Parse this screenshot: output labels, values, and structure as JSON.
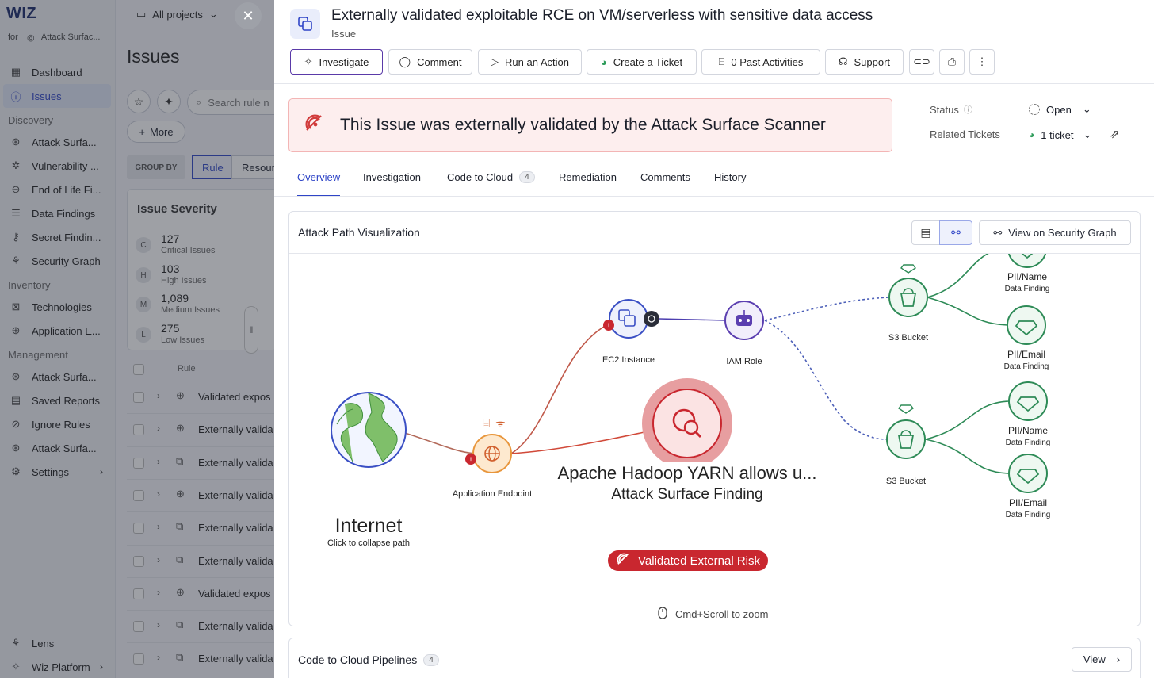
{
  "app": {
    "logo": "WIZ",
    "for_label": "for",
    "workspace": "Attack Surfac...",
    "project_selector": "All projects"
  },
  "sidebar": {
    "top_items": [
      {
        "label": "Dashboard",
        "icon": "dashboard-icon"
      },
      {
        "label": "Issues",
        "icon": "issues-icon",
        "active": true
      }
    ],
    "discovery_label": "Discovery",
    "discovery_items": [
      {
        "label": "Attack Surfa...",
        "icon": "attack-surface-icon"
      },
      {
        "label": "Vulnerability ...",
        "icon": "vulnerability-icon"
      },
      {
        "label": "End of Life Fi...",
        "icon": "end-of-life-icon"
      },
      {
        "label": "Data Findings",
        "icon": "database-icon"
      },
      {
        "label": "Secret Findin...",
        "icon": "key-icon"
      },
      {
        "label": "Security Graph",
        "icon": "graph-icon"
      }
    ],
    "inventory_label": "Inventory",
    "inventory_items": [
      {
        "label": "Technologies",
        "icon": "technologies-icon"
      },
      {
        "label": "Application E...",
        "icon": "globe-icon"
      }
    ],
    "management_label": "Management",
    "management_items": [
      {
        "label": "Attack Surfa...",
        "icon": "attack-surface-icon"
      },
      {
        "label": "Saved Reports",
        "icon": "report-icon"
      },
      {
        "label": "Ignore Rules",
        "icon": "ignore-icon"
      },
      {
        "label": "Attack Surfa...",
        "icon": "attack-surface-icon"
      },
      {
        "label": "Settings",
        "icon": "gear-icon"
      }
    ],
    "bottom_items": [
      {
        "label": "Lens",
        "icon": "lens-icon"
      },
      {
        "label": "Wiz Platform",
        "icon": "platform-icon"
      }
    ]
  },
  "issues_page": {
    "title": "Issues",
    "search_placeholder": "Search rule n",
    "more_label": "More",
    "group_by_label": "GROUP BY",
    "group_rule": "Rule",
    "group_resource": "Resour",
    "severity": {
      "title": "Issue Severity",
      "rows": [
        {
          "badge": "C",
          "count": "127",
          "label": "Critical Issues"
        },
        {
          "badge": "H",
          "count": "103",
          "label": "High Issues"
        },
        {
          "badge": "M",
          "count": "1,089",
          "label": "Medium Issues"
        },
        {
          "badge": "L",
          "count": "275",
          "label": "Low Issues"
        }
      ]
    },
    "table_header": "Rule",
    "rows": [
      {
        "icon": "globe-icon",
        "text": "Validated expos"
      },
      {
        "icon": "globe-icon",
        "text": "Externally valida"
      },
      {
        "icon": "copy-icon",
        "text": "Externally valida"
      },
      {
        "icon": "globe-icon",
        "text": "Externally valida"
      },
      {
        "icon": "copy-icon",
        "text": "Externally valida"
      },
      {
        "icon": "copy-icon",
        "text": "Externally valida"
      },
      {
        "icon": "globe-icon",
        "text": "Validated expos"
      },
      {
        "icon": "copy-icon",
        "text": "Externally valida"
      },
      {
        "icon": "copy-icon",
        "text": "Externally valida"
      }
    ]
  },
  "drawer": {
    "title": "Externally validated exploitable RCE on VM/serverless with sensitive data access",
    "subtitle": "Issue",
    "toolbar": {
      "investigate": "Investigate",
      "comment": "Comment",
      "run_action": "Run an Action",
      "create_ticket": "Create a Ticket",
      "past_activities": "0 Past Activities",
      "support": "Support"
    },
    "banner_text": "This Issue was externally validated by the Attack Surface Scanner",
    "status_label": "Status",
    "status_value": "Open",
    "related_tickets_label": "Related Tickets",
    "related_tickets_value": "1 ticket",
    "tabs": [
      {
        "label": "Overview",
        "active": true
      },
      {
        "label": "Investigation"
      },
      {
        "label": "Code to Cloud",
        "count": "4"
      },
      {
        "label": "Remediation"
      },
      {
        "label": "Comments"
      },
      {
        "label": "History"
      }
    ],
    "viz": {
      "title": "Attack Path Visualization",
      "security_graph_button": "View on Security Graph",
      "nodes": {
        "internet": {
          "label": "Internet",
          "sub": "Click to collapse path"
        },
        "app_endpoint": {
          "label": "Application Endpoint"
        },
        "ec2": {
          "label": "EC2 Instance"
        },
        "iam": {
          "label": "IAM Role"
        },
        "finding": {
          "label": "Apache Hadoop YARN allows u...",
          "sub": "Attack Surface Finding",
          "risk": "Validated External Risk"
        },
        "s3_top": {
          "label": "S3 Bucket"
        },
        "s3_bottom": {
          "label": "S3 Bucket"
        },
        "pii1": {
          "label": "PII/Name",
          "sub": "Data Finding"
        },
        "pii2": {
          "label": "PII/Email",
          "sub": "Data Finding"
        },
        "pii3": {
          "label": "PII/Name",
          "sub": "Data Finding"
        },
        "pii4": {
          "label": "PII/Email",
          "sub": "Data Finding"
        }
      },
      "zoom_hint": "Cmd+Scroll to zoom"
    },
    "code_to_cloud": {
      "title": "Code to Cloud Pipelines",
      "count": "4",
      "view_button": "View"
    }
  },
  "colors": {
    "accent": "#2f45c7",
    "critical": "#c9272f",
    "green": "#2e8b57",
    "orange": "#e8963c",
    "purple": "#5b3fb0"
  }
}
